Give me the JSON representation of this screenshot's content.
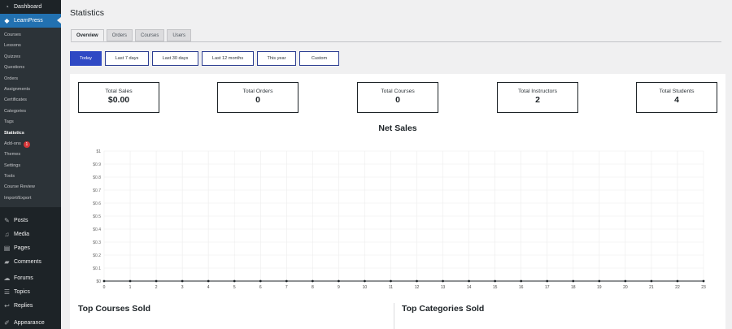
{
  "sidebar": {
    "dashboard": "Dashboard",
    "learnpress": "LearnPress",
    "submenu": [
      {
        "label": "Courses"
      },
      {
        "label": "Lessons"
      },
      {
        "label": "Quizzes"
      },
      {
        "label": "Questions"
      },
      {
        "label": "Orders"
      },
      {
        "label": "Assignments"
      },
      {
        "label": "Certificates"
      },
      {
        "label": "Categories"
      },
      {
        "label": "Tags"
      },
      {
        "label": "Statistics"
      },
      {
        "label": "Add-ons",
        "badge": "1"
      },
      {
        "label": "Themes"
      },
      {
        "label": "Settings"
      },
      {
        "label": "Tools"
      },
      {
        "label": "Course Review"
      },
      {
        "label": "Import/Export"
      }
    ],
    "lower": [
      {
        "label": "Posts",
        "icon": "pin-icon"
      },
      {
        "label": "Media",
        "icon": "media-icon"
      },
      {
        "label": "Pages",
        "icon": "page-icon"
      },
      {
        "label": "Comments",
        "icon": "comment-icon"
      },
      {
        "label": "Forums",
        "icon": "forum-icon"
      },
      {
        "label": "Topics",
        "icon": "topic-icon"
      },
      {
        "label": "Replies",
        "icon": "reply-icon"
      },
      {
        "label": "Appearance",
        "icon": "brush-icon"
      }
    ]
  },
  "page": {
    "title": "Statistics"
  },
  "tabs": [
    "Overview",
    "Orders",
    "Courses",
    "Users"
  ],
  "filters": [
    "Today",
    "Last 7 days",
    "Last 30 days",
    "Last 12 months",
    "This year",
    "Custom"
  ],
  "stats": [
    {
      "label": "Total Sales",
      "value": "$0.00"
    },
    {
      "label": "Total Orders",
      "value": "0"
    },
    {
      "label": "Total Courses",
      "value": "0"
    },
    {
      "label": "Total Instructors",
      "value": "2"
    },
    {
      "label": "Total Students",
      "value": "4"
    }
  ],
  "chart_data": {
    "type": "line",
    "title": "Net Sales",
    "x": [
      0,
      1,
      2,
      3,
      4,
      5,
      6,
      7,
      8,
      9,
      10,
      11,
      12,
      13,
      14,
      15,
      16,
      17,
      18,
      19,
      20,
      21,
      22,
      23
    ],
    "y_ticks": [
      "$1",
      "$0.9",
      "$0.8",
      "$0.7",
      "$0.6",
      "$0.5",
      "$0.4",
      "$0.3",
      "$0.2",
      "$0.1",
      "$0"
    ],
    "ylim": [
      0,
      1
    ],
    "series": [
      {
        "values": [
          0,
          0,
          0,
          0,
          0,
          0,
          0,
          0,
          0,
          0,
          0,
          0,
          0,
          0,
          0,
          0,
          0,
          0,
          0,
          0,
          0,
          0,
          0,
          0
        ]
      }
    ],
    "grid": true,
    "line_color": "#1d2327"
  },
  "bottom": {
    "top_courses": "Top Courses Sold",
    "top_categories": "Top Categories Sold"
  },
  "colors": {
    "accent": "#2271b1",
    "filter_active": "#2f49c4",
    "sidebar": "#1d2327"
  }
}
